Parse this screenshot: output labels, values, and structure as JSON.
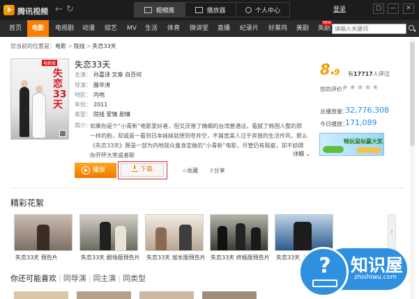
{
  "app": {
    "name": "腾讯视频"
  },
  "titlebar": {
    "tabs": [
      "视频库",
      "播放器",
      "个人中心"
    ],
    "login": "登录",
    "controls": [
      "▢",
      "—",
      "✕"
    ]
  },
  "nav": {
    "items": [
      "首页",
      "电影",
      "电视剧",
      "动漫",
      "综艺",
      "MV",
      "生活",
      "体育",
      "微讲堂",
      "直播",
      "纪录片",
      "好莱坞",
      "美剧",
      "英剧"
    ],
    "active": "电影",
    "new_badge": "NEW",
    "search_placeholder": "请输入关键词"
  },
  "breadcrumb": {
    "prefix": "您当前的位置是：",
    "items": [
      "电影",
      "院线",
      "失恋33天"
    ]
  },
  "poster": {
    "badge": "电影版",
    "title": "失恋33天"
  },
  "movie": {
    "title": "失恋33天",
    "lbl_actors": "主演：",
    "actors": "孙嘉译  文章  白百何",
    "lbl_director": "导演：",
    "director": "滕华涛",
    "lbl_region": "地区：",
    "region": "内地",
    "lbl_year": "年份：",
    "year": "2011",
    "lbl_genre": "类型：",
    "genre": "院线  爱情  剧情",
    "lbl_synopsis": "简介：",
    "synopsis": "如果你是个“小青新”电影爱好者，但又厌倦了精细的台湾普通话，看腻了韩国人整的那一样的脸，却或是一看到日本妹妹就想到苍井空，不屑宽美人过于奔放的生活作风，那么《失恋33天》算是一部为内地观众量身定做的“小青新”电影，尽管仍有瑕疵，却不妨碍你开怀大笑或者眼",
    "detail": "详细 ⌄"
  },
  "actions": {
    "play": "播放",
    "download": "下载",
    "favorite": "☆收藏",
    "share": "⇪分享"
  },
  "rating": {
    "score_int": "8.",
    "score_dec": "9",
    "prefix": "有",
    "count": "17717",
    "suffix": "人评过",
    "your_rating_label": "您的评价：",
    "stars": "★★★★★",
    "total_label": "总播放量：",
    "total": "32,776,308",
    "today_label": "今日播放：",
    "today": "171,089"
  },
  "ad": {
    "text": "畅玩鼠标赢大奖"
  },
  "highlights": {
    "title": "精彩花絮",
    "items": [
      "失恋33天  预告片",
      "失恋33天  剧场版预告片",
      "失恋33天  加长版预告片",
      "失恋33天  终极版预告片",
      "失恋33天  人物"
    ],
    "more": "›"
  },
  "recommend": {
    "tabs": [
      "你还可能喜欢",
      "同导演",
      "同主演",
      "同类型"
    ]
  },
  "watermark": {
    "name": "知识屋",
    "url": "zhishiwu.com"
  },
  "colors": {
    "accent": "#ff7e00",
    "link_blue": "#1f8be0",
    "score": "#f0a000",
    "highlight_red": "#e12020"
  }
}
